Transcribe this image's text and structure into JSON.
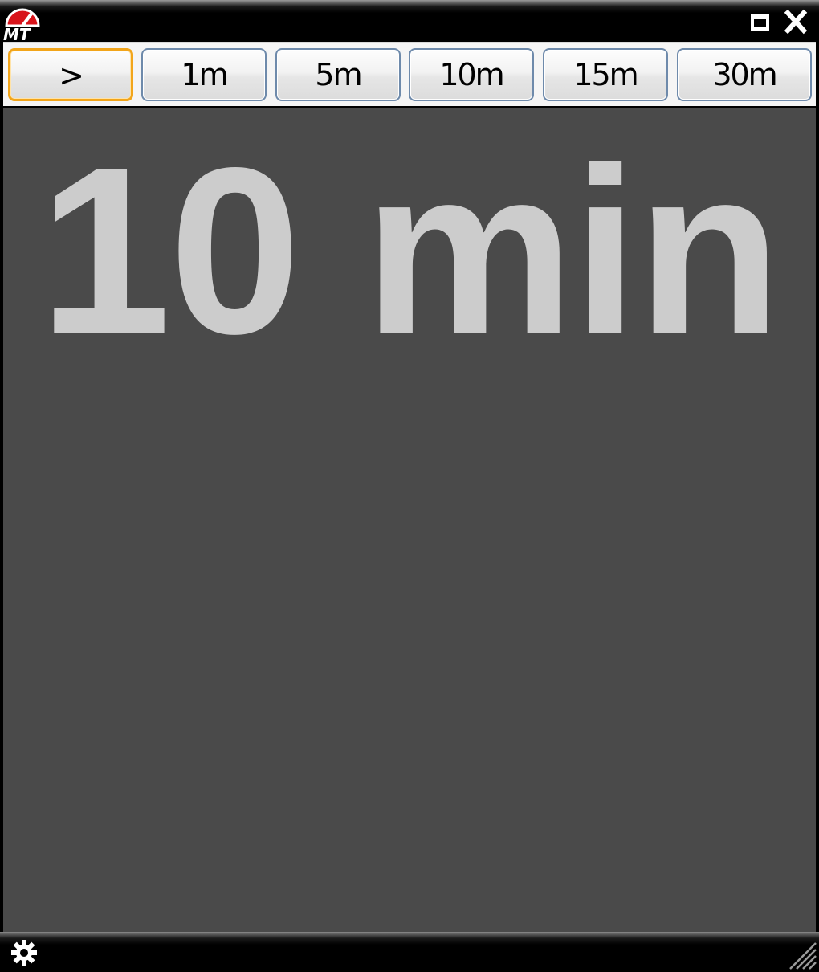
{
  "titlebar": {
    "logo_text": "MT",
    "restore_icon": "restore-icon",
    "close_icon": "close-icon"
  },
  "buttons": [
    {
      "label": ">",
      "active": true
    },
    {
      "label": "1m",
      "active": false
    },
    {
      "label": "5m",
      "active": false
    },
    {
      "label": "10m",
      "active": false
    },
    {
      "label": "15m",
      "active": false
    },
    {
      "label": "30m",
      "active": false
    }
  ],
  "display": {
    "text": "10 min"
  },
  "statusbar": {
    "settings_icon": "gear-icon",
    "resize_icon": "resize-grip-icon"
  },
  "colors": {
    "display_bg": "#4a4a4a",
    "display_text": "#cccccc",
    "active_border": "#f2a51a",
    "button_border": "#6e8aab",
    "logo_red": "#d8131a"
  }
}
